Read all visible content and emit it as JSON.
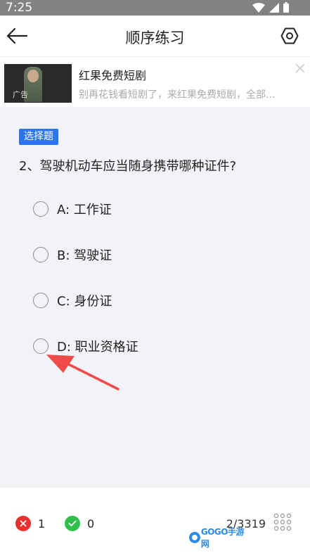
{
  "status_bar": {
    "time": "7:25"
  },
  "nav": {
    "title": "顺序练习"
  },
  "ad": {
    "title": "红果免费短剧",
    "description": "别再花钱看短剧了，来红果免费短剧，全部...",
    "tag": "广告"
  },
  "question": {
    "type_badge": "选择题",
    "text": "2、驾驶机动车应当随身携带哪种证件?",
    "options": [
      {
        "label": "A: 工作证"
      },
      {
        "label": "B: 驾驶证"
      },
      {
        "label": "C: 身份证"
      },
      {
        "label": "D: 职业资格证"
      }
    ]
  },
  "footer": {
    "wrong_count": "1",
    "right_count": "0",
    "progress": "2/3319",
    "watermark": "GOGO手游网"
  },
  "colors": {
    "accent": "#2d74f2",
    "wrong": "#e8312f",
    "right": "#2fbf4a",
    "arrow": "#f04a4a"
  }
}
